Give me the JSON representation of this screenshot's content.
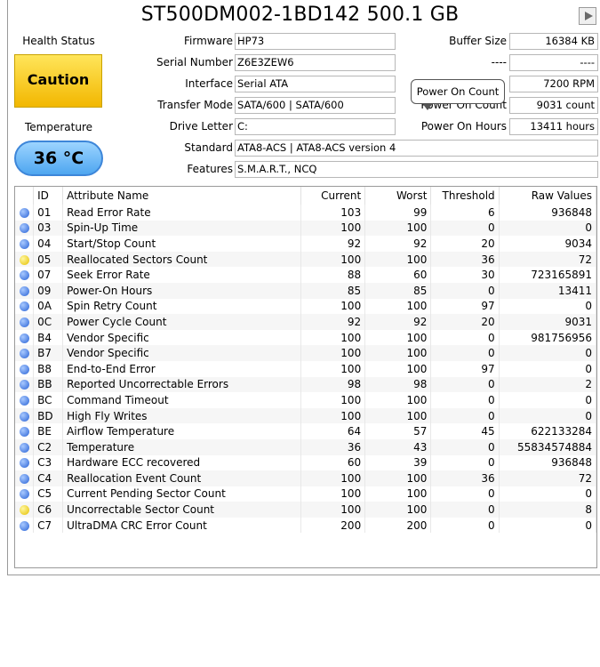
{
  "title": "ST500DM002-1BD142 500.1 GB",
  "health": {
    "label": "Health Status",
    "status": "Caution",
    "color": "#f2b700"
  },
  "temperature": {
    "label": "Temperature",
    "value": "36 °C",
    "color": "#4ea6f0"
  },
  "fields": {
    "firmware": {
      "label": "Firmware",
      "value": "HP73"
    },
    "serial": {
      "label": "Serial Number",
      "value": "Z6E3ZEW6"
    },
    "interface": {
      "label": "Interface",
      "value": "Serial ATA"
    },
    "transfer_mode": {
      "label": "Transfer Mode",
      "value": "SATA/600 | SATA/600"
    },
    "drive_letter": {
      "label": "Drive Letter",
      "value": "C:"
    },
    "standard": {
      "label": "Standard",
      "value": "ATA8-ACS | ATA8-ACS version 4"
    },
    "features": {
      "label": "Features",
      "value": "S.M.A.R.T., NCQ"
    },
    "buffer_size": {
      "label": "Buffer Size",
      "value": "16384 KB"
    },
    "unknown": {
      "label": "----",
      "value": "----"
    },
    "rotation": {
      "value": "7200 RPM"
    },
    "power_on_count": {
      "label": "Power On Count",
      "value": "9031 count"
    },
    "power_on_hours": {
      "label": "Power On Hours",
      "value": "13411 hours"
    }
  },
  "tooltip": {
    "text": "Power On Count"
  },
  "smart_table": {
    "headers": [
      "",
      "ID",
      "Attribute Name",
      "Current",
      "Worst",
      "Threshold",
      "Raw Values"
    ],
    "rows": [
      {
        "status": "good",
        "id": "01",
        "name": "Read Error Rate",
        "current": "103",
        "worst": "99",
        "threshold": "6",
        "raw": "936848"
      },
      {
        "status": "good",
        "id": "03",
        "name": "Spin-Up Time",
        "current": "100",
        "worst": "100",
        "threshold": "0",
        "raw": "0"
      },
      {
        "status": "good",
        "id": "04",
        "name": "Start/Stop Count",
        "current": "92",
        "worst": "92",
        "threshold": "20",
        "raw": "9034"
      },
      {
        "status": "caution",
        "id": "05",
        "name": "Reallocated Sectors Count",
        "current": "100",
        "worst": "100",
        "threshold": "36",
        "raw": "72"
      },
      {
        "status": "good",
        "id": "07",
        "name": "Seek Error Rate",
        "current": "88",
        "worst": "60",
        "threshold": "30",
        "raw": "723165891"
      },
      {
        "status": "good",
        "id": "09",
        "name": "Power-On Hours",
        "current": "85",
        "worst": "85",
        "threshold": "0",
        "raw": "13411"
      },
      {
        "status": "good",
        "id": "0A",
        "name": "Spin Retry Count",
        "current": "100",
        "worst": "100",
        "threshold": "97",
        "raw": "0"
      },
      {
        "status": "good",
        "id": "0C",
        "name": "Power Cycle Count",
        "current": "92",
        "worst": "92",
        "threshold": "20",
        "raw": "9031"
      },
      {
        "status": "good",
        "id": "B4",
        "name": "Vendor Specific",
        "current": "100",
        "worst": "100",
        "threshold": "0",
        "raw": "981756956"
      },
      {
        "status": "good",
        "id": "B7",
        "name": "Vendor Specific",
        "current": "100",
        "worst": "100",
        "threshold": "0",
        "raw": "0"
      },
      {
        "status": "good",
        "id": "B8",
        "name": "End-to-End Error",
        "current": "100",
        "worst": "100",
        "threshold": "97",
        "raw": "0"
      },
      {
        "status": "good",
        "id": "BB",
        "name": "Reported Uncorrectable Errors",
        "current": "98",
        "worst": "98",
        "threshold": "0",
        "raw": "2"
      },
      {
        "status": "good",
        "id": "BC",
        "name": "Command Timeout",
        "current": "100",
        "worst": "100",
        "threshold": "0",
        "raw": "0"
      },
      {
        "status": "good",
        "id": "BD",
        "name": "High Fly Writes",
        "current": "100",
        "worst": "100",
        "threshold": "0",
        "raw": "0"
      },
      {
        "status": "good",
        "id": "BE",
        "name": "Airflow Temperature",
        "current": "64",
        "worst": "57",
        "threshold": "45",
        "raw": "622133284"
      },
      {
        "status": "good",
        "id": "C2",
        "name": "Temperature",
        "current": "36",
        "worst": "43",
        "threshold": "0",
        "raw": "55834574884"
      },
      {
        "status": "good",
        "id": "C3",
        "name": "Hardware ECC recovered",
        "current": "60",
        "worst": "39",
        "threshold": "0",
        "raw": "936848"
      },
      {
        "status": "good",
        "id": "C4",
        "name": "Reallocation Event Count",
        "current": "100",
        "worst": "100",
        "threshold": "36",
        "raw": "72"
      },
      {
        "status": "good",
        "id": "C5",
        "name": "Current Pending Sector Count",
        "current": "100",
        "worst": "100",
        "threshold": "0",
        "raw": "0"
      },
      {
        "status": "caution",
        "id": "C6",
        "name": "Uncorrectable Sector Count",
        "current": "100",
        "worst": "100",
        "threshold": "0",
        "raw": "8"
      },
      {
        "status": "good",
        "id": "C7",
        "name": "UltraDMA CRC Error Count",
        "current": "200",
        "worst": "200",
        "threshold": "0",
        "raw": "0"
      }
    ]
  },
  "icons": {
    "play": "play-icon",
    "good": "blue-dot-icon",
    "caution": "yellow-dot-icon"
  }
}
